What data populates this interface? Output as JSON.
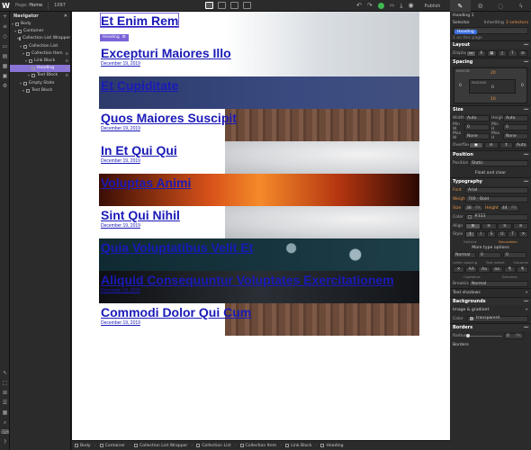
{
  "topbar": {
    "logo": "W",
    "page_label": "Page:",
    "page_name": "Home",
    "breakpoint": "1097",
    "publish_label": "Publish",
    "panel_tab_icons": [
      "brush-icon",
      "gear-icon",
      "drop-icon",
      "lightning-icon"
    ]
  },
  "navigator": {
    "title": "Navigator",
    "items": [
      {
        "label": "Body",
        "indent": 0
      },
      {
        "label": "Container",
        "indent": 1
      },
      {
        "label": "Collection List Wrapper",
        "indent": 2
      },
      {
        "label": "Collection List",
        "indent": 3
      },
      {
        "label": "Collection Item",
        "indent": 4
      },
      {
        "label": "Link Block",
        "indent": 5
      },
      {
        "label": "Heading",
        "indent": 6,
        "selected": true
      },
      {
        "label": "Text Block",
        "indent": 6
      },
      {
        "label": "Empty State",
        "indent": 3
      },
      {
        "label": "Text Block",
        "indent": 4
      }
    ]
  },
  "canvas": {
    "selected_tag": "Heading",
    "items": [
      {
        "title": "Et Enim Rem",
        "date": "",
        "bg": "plain"
      },
      {
        "title": "Excepturi Maiores Illo",
        "date": "December 19, 2019",
        "bg": "plain"
      },
      {
        "title": "Et Cupiditate",
        "date": "",
        "bg": "navy"
      },
      {
        "title": "Quos Maiores Suscipit",
        "date": "December 19, 2019",
        "bg": "wood"
      },
      {
        "title": "In Et Qui Qui",
        "date": "December 19, 2019",
        "bg": "plate"
      },
      {
        "title": "Voluptas Animi",
        "date": "",
        "bg": "fire"
      },
      {
        "title": "Sint Qui Nihil",
        "date": "December 19, 2019",
        "bg": "plate"
      },
      {
        "title": "Quia Voluptatibus Velit Et",
        "date": "",
        "bg": "bokeh"
      },
      {
        "title": "Aliquid Consequuntur Voluptates Exercitationem",
        "date": "December 19, 2019",
        "bg": "dark"
      },
      {
        "title": "Commodi Dolor Qui Cum",
        "date": "December 19, 2019",
        "bg": "wood"
      }
    ]
  },
  "breadcrumb": [
    "Body",
    "Container",
    "Collection List Wrapper",
    "Collection List",
    "Collection Item",
    "Link Block",
    "Heading"
  ],
  "panel": {
    "element_name": "Heading 1",
    "selector_label": "Selector",
    "selector_info": "Inheriting",
    "selector_count": "3 selectors",
    "selector_chip": "Heading",
    "on_page": "1 on this page",
    "layout_title": "Layout",
    "display_label": "Display",
    "spacing_title": "Spacing",
    "margin_label": "MARGIN",
    "padding_label": "PADDING",
    "margin_top": "20",
    "margin_bottom": "10",
    "padding_value": "0",
    "margin_side": "0",
    "size_title": "Size",
    "width_label": "Width",
    "width_value": "Auto",
    "height_label": "Height",
    "height_value": "Auto",
    "minw_label": "Min W",
    "minw_value": "0",
    "minh_label": "Min H",
    "minh_value": "0",
    "maxw_label": "Max W",
    "maxw_value": "None",
    "maxh_label": "Max H",
    "maxh_value": "None",
    "overflow_label": "Overflow",
    "overflow_auto": "Auto",
    "position_title": "Position",
    "position_label": "Position",
    "position_value": "Static",
    "float_label": "Float and clear",
    "typography_title": "Typography",
    "font_label": "Font",
    "font_value": "Arial",
    "weight_label": "Weight",
    "weight_value": "700 - Bold",
    "size_label": "Size",
    "size_value": "38",
    "size_unit": "PX",
    "lh_label": "Height",
    "lh_value": "44",
    "lh_unit": "PX",
    "color_label": "Color",
    "color_value": "#333",
    "align_label": "Align",
    "style_label": "Style",
    "italic_label": "Italicize",
    "decoration_label": "Decoration",
    "more_type": "More type options",
    "letter_label": "Letter spacing",
    "indent_label": "Text indent",
    "columns_label": "Columns",
    "normal_value": "Normal",
    "zero_value": "0",
    "capitalize_label": "Capitalize",
    "direction_label": "Direction",
    "breaking_label": "Breaking",
    "breaking_value": "Normal",
    "text_shadows": "Text shadows",
    "backgrounds_title": "Backgrounds",
    "image_gradient": "Image & gradient",
    "bg_color_label": "Color",
    "bg_color_value": "transparent",
    "borders_title": "Borders",
    "radius_label": "Radius",
    "radius_value": "0",
    "radius_unit": "PX",
    "borders_label": "Borders"
  }
}
